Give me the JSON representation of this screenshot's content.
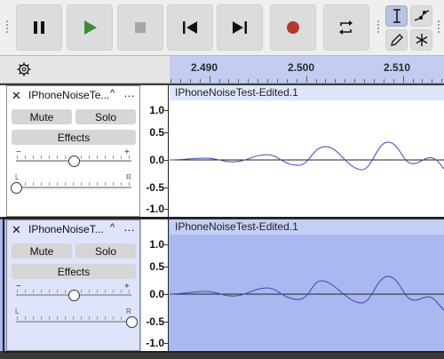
{
  "toolbar": {
    "transport": [
      "pause",
      "play",
      "stop",
      "skip-to-start",
      "skip-to-end",
      "record",
      "loop"
    ],
    "tools": [
      "selection-tool",
      "envelope-tool",
      "draw-tool",
      "multi-tool"
    ]
  },
  "ruler": {
    "labels": [
      "2.490",
      "2.500",
      "2.510"
    ]
  },
  "tracks": [
    {
      "name": "IPhoneNoiseTe...",
      "close_glyph": "✕",
      "collapse_glyph": "^",
      "menu_glyph": "…",
      "mute_label": "Mute",
      "solo_label": "Solo",
      "effects_label": "Effects",
      "gain_minus": "−",
      "gain_plus": "+",
      "pan_left": "L",
      "pan_right": "R",
      "gain_level": 0.5,
      "pan_level": 0.0,
      "clip_name": "IPhoneNoiseTest-Edited.1",
      "scale": [
        "1.0",
        "0.5",
        "0.0",
        "-0.5",
        "-1.0"
      ],
      "selected": false
    },
    {
      "name": "IPhoneNoiseT...",
      "close_glyph": "✕",
      "collapse_glyph": "^",
      "menu_glyph": "…",
      "mute_label": "Mute",
      "solo_label": "Solo",
      "effects_label": "Effects",
      "gain_minus": "−",
      "gain_plus": "+",
      "pan_left": "L",
      "pan_right": "R",
      "gain_level": 0.5,
      "pan_level": 1.0,
      "clip_name": "IPhoneNoiseTest-Edited.1",
      "scale": [
        "1.0",
        "0.5",
        "0.0",
        "-0.5",
        "-1.0"
      ],
      "selected": true
    }
  ],
  "colors": {
    "selection": "#c3cdf1",
    "selected_track": "#aab8ef",
    "selected_ctrl": "#dde4fb",
    "waveform": "#3a48b8",
    "record": "#b23a30",
    "play": "#3d8a3d"
  }
}
